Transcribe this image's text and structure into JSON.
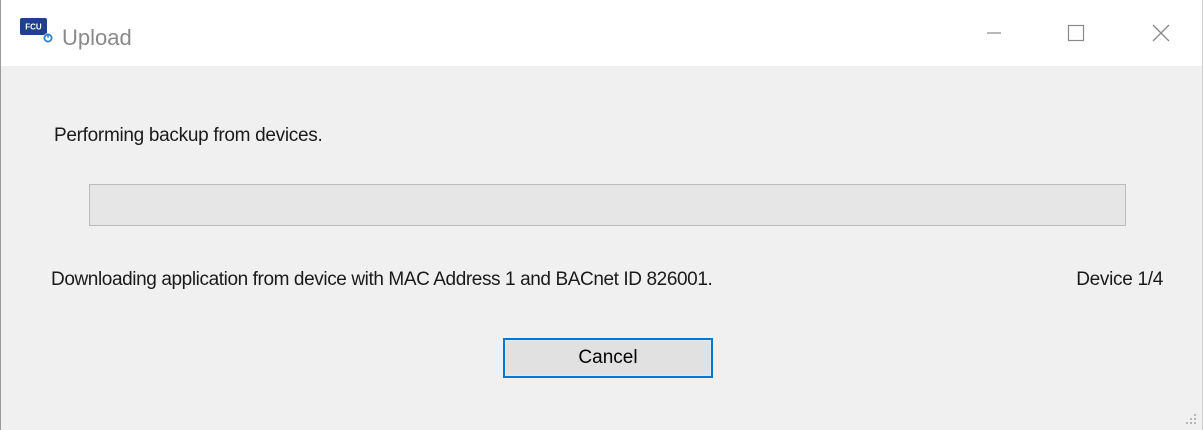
{
  "window": {
    "title": "Upload",
    "app_icon_text": "FCU"
  },
  "dialog": {
    "message": "Performing backup from devices.",
    "progress": 0,
    "status_text": "Downloading application from device with MAC Address 1 and BACnet ID 826001.",
    "device_count": "Device 1/4",
    "cancel_label": "Cancel"
  },
  "colors": {
    "accent": "#0078d7",
    "app_icon": "#1f3f8f",
    "progress_fill": "#06b025"
  },
  "icons": {
    "minimize": "minimize-icon",
    "maximize": "maximize-icon",
    "close": "close-icon",
    "resize": "resize-grip-icon"
  }
}
